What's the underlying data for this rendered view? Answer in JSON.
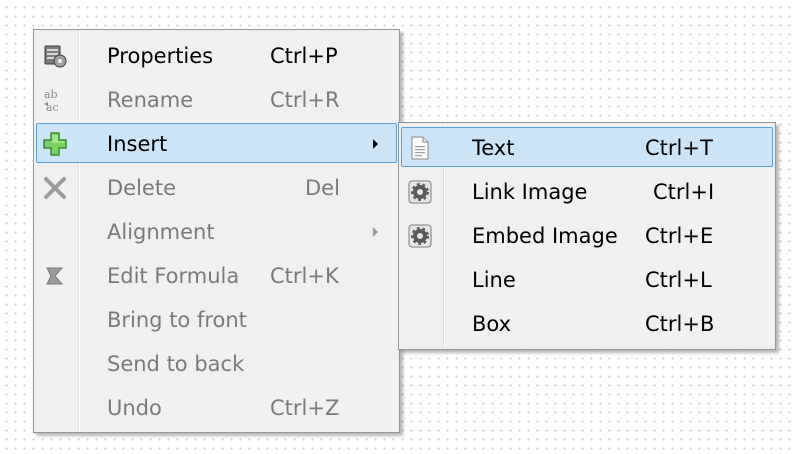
{
  "main_menu": {
    "items": [
      {
        "label": "Properties",
        "shortcut": "Ctrl+P",
        "icon": "properties-icon",
        "enabled": true
      },
      {
        "label": "Rename",
        "shortcut": "Ctrl+R",
        "icon": "rename-icon",
        "enabled": false
      },
      {
        "label": "Insert",
        "shortcut": "",
        "icon": "insert-plus-icon",
        "enabled": true,
        "submenu": true,
        "highlighted": true
      },
      {
        "label": "Delete",
        "shortcut": "Del",
        "icon": "delete-x-icon",
        "enabled": false
      },
      {
        "label": "Alignment",
        "shortcut": "",
        "icon": "",
        "enabled": false,
        "submenu": true
      },
      {
        "label": "Edit Formula",
        "shortcut": "Ctrl+K",
        "icon": "formula-icon",
        "enabled": false
      },
      {
        "label": "Bring to front",
        "shortcut": "",
        "icon": "",
        "enabled": false
      },
      {
        "label": "Send to back",
        "shortcut": "",
        "icon": "",
        "enabled": false
      },
      {
        "label": "Undo",
        "shortcut": "Ctrl+Z",
        "icon": "",
        "enabled": false
      }
    ]
  },
  "insert_submenu": {
    "items": [
      {
        "label": "Text",
        "shortcut": "Ctrl+T",
        "icon": "text-document-icon",
        "highlighted": true
      },
      {
        "label": "Link Image",
        "shortcut": "Ctrl+I",
        "icon": "gear-icon"
      },
      {
        "label": "Embed Image",
        "shortcut": "Ctrl+E",
        "icon": "gear-icon"
      },
      {
        "label": "Line",
        "shortcut": "Ctrl+L",
        "icon": ""
      },
      {
        "label": "Box",
        "shortcut": "Ctrl+B",
        "icon": ""
      }
    ]
  },
  "colors": {
    "menu_background": "#f0f0f0",
    "highlight_fill": "#cce4f7",
    "highlight_border": "#5aa0d8",
    "disabled_text": "#7a7a7a"
  }
}
